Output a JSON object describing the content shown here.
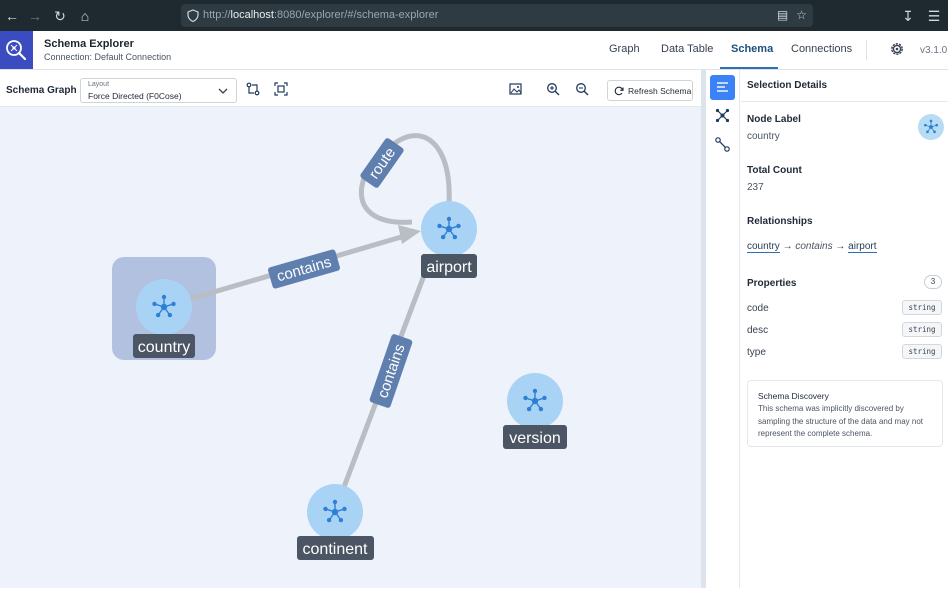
{
  "browser": {
    "url_prefix": "http://",
    "url_host": "localhost",
    "url_rest": ":8080/explorer/#/schema-explorer"
  },
  "header": {
    "title": "Schema Explorer",
    "connection": "Connection: Default Connection",
    "tabs": [
      "Graph",
      "Data Table",
      "Schema",
      "Connections"
    ],
    "active_tab": "Schema",
    "version": "v3.1.0"
  },
  "toolbar": {
    "title": "Schema Graph",
    "layout_caption": "Layout",
    "layout_value": "Force Directed (F0Cose)",
    "refresh_label": "Refresh Schema"
  },
  "graph": {
    "nodes": [
      {
        "id": "country",
        "label": "country",
        "selected": true
      },
      {
        "id": "airport",
        "label": "airport",
        "selected": false
      },
      {
        "id": "continent",
        "label": "continent",
        "selected": false
      },
      {
        "id": "version",
        "label": "version",
        "selected": false
      }
    ],
    "edges": [
      {
        "from": "country",
        "to": "airport",
        "label": "contains"
      },
      {
        "from": "airport",
        "to": "airport",
        "label": "route"
      },
      {
        "from": "continent",
        "to": "airport",
        "label": "contains"
      }
    ],
    "colors": {
      "canvas": "#eef2fb",
      "node": "#a9d3f5",
      "node_icon": "#2f7fd6",
      "edge": "#b9bdc4",
      "edge_label": "#5f7fae",
      "node_label_bg": "#4b5563",
      "selection": "#9fb0d8"
    }
  },
  "details": {
    "title": "Selection Details",
    "node_label_heading": "Node Label",
    "node_label_value": "country",
    "total_count_heading": "Total Count",
    "total_count_value": "237",
    "relationships_heading": "Relationships",
    "relationship": {
      "from": "country",
      "arrow": "→",
      "edge": "contains",
      "to": "airport"
    },
    "properties_heading": "Properties",
    "properties_count": "3",
    "properties": [
      {
        "name": "code",
        "type": "string"
      },
      {
        "name": "desc",
        "type": "string"
      },
      {
        "name": "type",
        "type": "string"
      }
    ],
    "note_title": "Schema Discovery",
    "note_body": "This schema was implicitly discovered by sampling the structure of the data and may not represent the complete schema."
  }
}
